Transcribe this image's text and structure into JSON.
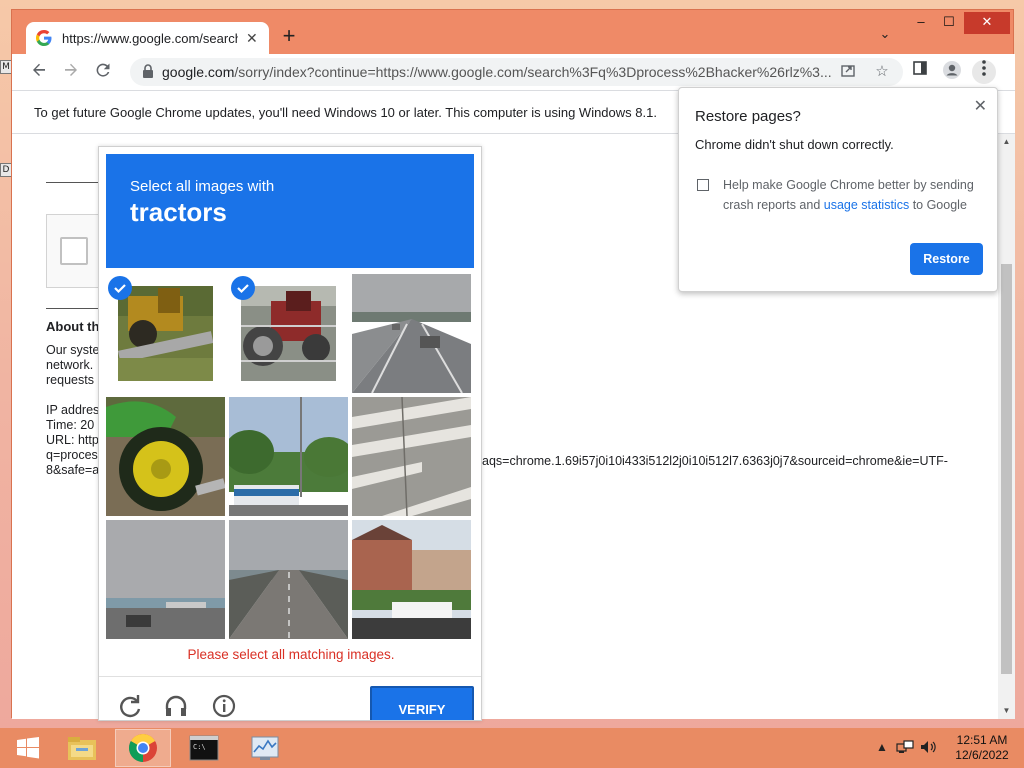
{
  "browser": {
    "tab": {
      "title": "https://www.google.com/search?q=process+hacker",
      "close_label": "✕"
    },
    "new_tab_label": "+",
    "tab_search_label": "⌄",
    "window_controls": {
      "minimize": "–",
      "maximize": "☐",
      "close": "✕"
    },
    "url": {
      "host": "google.com",
      "path": "/sorry/index?continue=https://www.google.com/search%3Fq%3Dprocess%2Bhacker%26rlz%3..."
    },
    "infobar": "To get future Google Chrome updates, you'll need Windows 10 or later. This computer is using Windows 8.1."
  },
  "page": {
    "heading": "About th",
    "body_lines": [
      "Our syste",
      "network.",
      "requests"
    ],
    "ip_lines": [
      "IP addres",
      "Time: 20",
      "URL: http",
      "q=proces",
      "8&safe=a"
    ],
    "url_tail": "aqs=chrome.1.69i57j0i10i433i512l2j0i10i512l7.6363j0j7&sourceid=chrome&ie=UTF-"
  },
  "captcha": {
    "instruction": "Select all images with",
    "target": "tractors",
    "tiles": [
      {
        "subject": "tractor",
        "selected": true
      },
      {
        "subject": "tractor",
        "selected": true
      },
      {
        "subject": "road",
        "selected": false
      },
      {
        "subject": "tractor-wheel",
        "selected": false
      },
      {
        "subject": "bus",
        "selected": false
      },
      {
        "subject": "crosswalk",
        "selected": false
      },
      {
        "subject": "shoreline",
        "selected": false
      },
      {
        "subject": "bridge",
        "selected": false
      },
      {
        "subject": "houses",
        "selected": false
      }
    ],
    "error": "Please select all matching images.",
    "verify_label": "VERIFY"
  },
  "restore": {
    "title": "Restore pages?",
    "message": "Chrome didn't shut down correctly.",
    "checkbox_text_before": "Help make Google Chrome better by sending crash reports and ",
    "checkbox_link": "usage statistics",
    "checkbox_text_after": " to Google",
    "button_label": "Restore",
    "close_label": "✕"
  },
  "taskbar": {
    "time": "12:51 AM",
    "date": "12/6/2022"
  },
  "colors": {
    "accent": "#1a73e8",
    "error": "#d93025",
    "frame": "#ef8a67"
  }
}
